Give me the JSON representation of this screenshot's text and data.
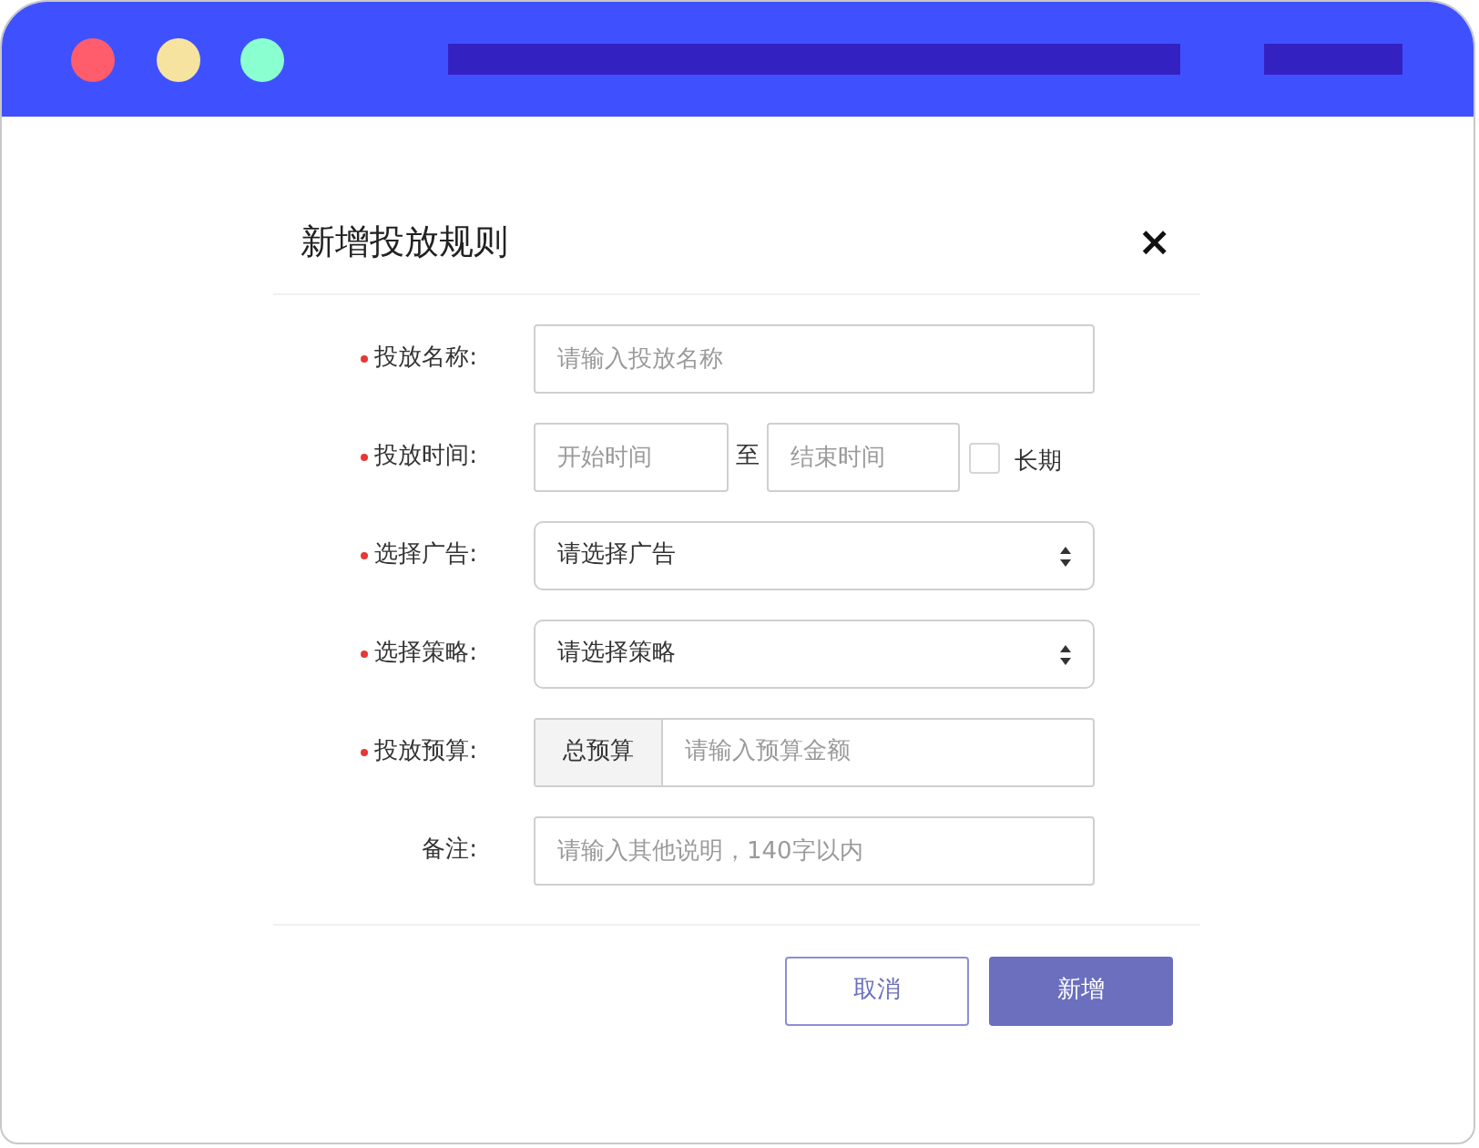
{
  "dialog": {
    "title": "新增投放规则",
    "close": "×",
    "fields": [
      {
        "kind": "text",
        "label": "投放名称:",
        "required": true,
        "placeholder": "请输入投放名称"
      },
      {
        "kind": "daterange",
        "label": "投放时间:",
        "required": true,
        "start_placeholder": "开始时间",
        "separator": "至",
        "end_placeholder": "结束时间",
        "checkbox": {
          "label": "长期",
          "checked": false
        }
      },
      {
        "kind": "select",
        "label": "选择广告:",
        "required": true,
        "value": "请选择广告"
      },
      {
        "kind": "select",
        "label": "选择策略:",
        "required": true,
        "value": "请选择策略"
      },
      {
        "kind": "addon",
        "label": "投放预算:",
        "required": true,
        "addon": "总预算",
        "placeholder": "请输入预算金额"
      },
      {
        "kind": "text",
        "label": "备注:",
        "required": false,
        "placeholder": "请输入其他说明，140字以内"
      }
    ],
    "buttons": [
      {
        "kind": "secondary",
        "label": "取消"
      },
      {
        "kind": "primary",
        "label": "新增"
      }
    ]
  }
}
